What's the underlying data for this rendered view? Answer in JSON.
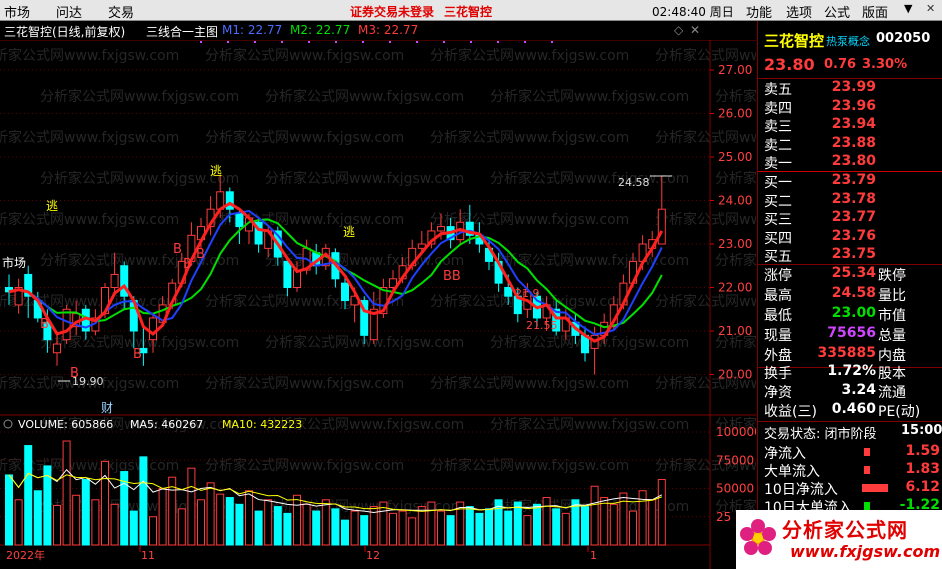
{
  "menu": {
    "market": "市场",
    "wenda": "问达",
    "trade": "交易",
    "warning": "证券交易未登录",
    "stock_title": "三花智控",
    "clock": "02:48:40 周日",
    "function": "功能",
    "option": "选项",
    "formula": "公式",
    "layout": "版面"
  },
  "subbar": {
    "name": "三花智控(日线,前复权)",
    "indicator": "三线合一主图",
    "m1": "M1: 22.77",
    "m2": "M2: 22.77",
    "m3": "M3: 22.77"
  },
  "price_axis": [
    "27.00",
    "26.00",
    "25.00",
    "24.00",
    "23.00",
    "22.00",
    "21.00",
    "20.00"
  ],
  "vol_axis": [
    "100000",
    "75000",
    "50000",
    "25"
  ],
  "vol_header": {
    "name": "VOLUME: 605866",
    "ma5": "MA5: 460267",
    "ma10": "MA10: 432223"
  },
  "x_labels": {
    "a": "2022年",
    "b": "11",
    "c": "12",
    "d": "1"
  },
  "annotations": {
    "hi": "24.58",
    "lo": "19.90",
    "mid1": "21.55",
    "mid2": "21.9",
    "cai": "财",
    "tao": "逃",
    "b": "B",
    "bb": "BB"
  },
  "watermark": "分析家公式网www.fxjgsw.com",
  "left_labels": {
    "market": "市场"
  },
  "quote": {
    "name": "三花智控",
    "concept": "热泵概念",
    "code": "002050",
    "price": "23.80",
    "change": "0.76",
    "pct": "3.30%",
    "asks": [
      [
        "卖五",
        "23.99"
      ],
      [
        "卖四",
        "23.96"
      ],
      [
        "卖三",
        "23.94"
      ],
      [
        "卖二",
        "23.88"
      ],
      [
        "卖一",
        "23.80"
      ]
    ],
    "bids": [
      [
        "买一",
        "23.79"
      ],
      [
        "买二",
        "23.78"
      ],
      [
        "买三",
        "23.77"
      ],
      [
        "买四",
        "23.76"
      ],
      [
        "买五",
        "23.75"
      ]
    ],
    "stats": [
      [
        "涨停",
        "25.34",
        "跌停",
        ""
      ],
      [
        "最高",
        "24.58",
        "量比",
        ""
      ],
      [
        "最低",
        "23.00",
        "市值",
        ""
      ],
      [
        "现量",
        "75656",
        "总量",
        ""
      ],
      [
        "外盘",
        "335885",
        "内盘",
        ""
      ]
    ],
    "stats2": [
      [
        "换手",
        "1.72%",
        "股本"
      ],
      [
        "净资",
        "3.24",
        "流通"
      ],
      [
        "收益(三)",
        "0.460",
        "PE(动)"
      ]
    ],
    "status": "交易状态: 闭市阶段",
    "status_time": "15:00",
    "flows": [
      [
        "净流入",
        "1.59"
      ],
      [
        "大单流入",
        "1.83"
      ],
      [
        "10日净流入",
        "6.12"
      ],
      [
        "10日大单流入",
        "-1.22"
      ]
    ]
  },
  "logo": {
    "text": "分析家公式网",
    "url": "www.fxjgsw.com"
  },
  "colors": {
    "up": "#ff3b3b",
    "down": "#00ffff",
    "m1": "#ff2020",
    "m2": "#00e000",
    "m3": "#2040ff"
  }
}
